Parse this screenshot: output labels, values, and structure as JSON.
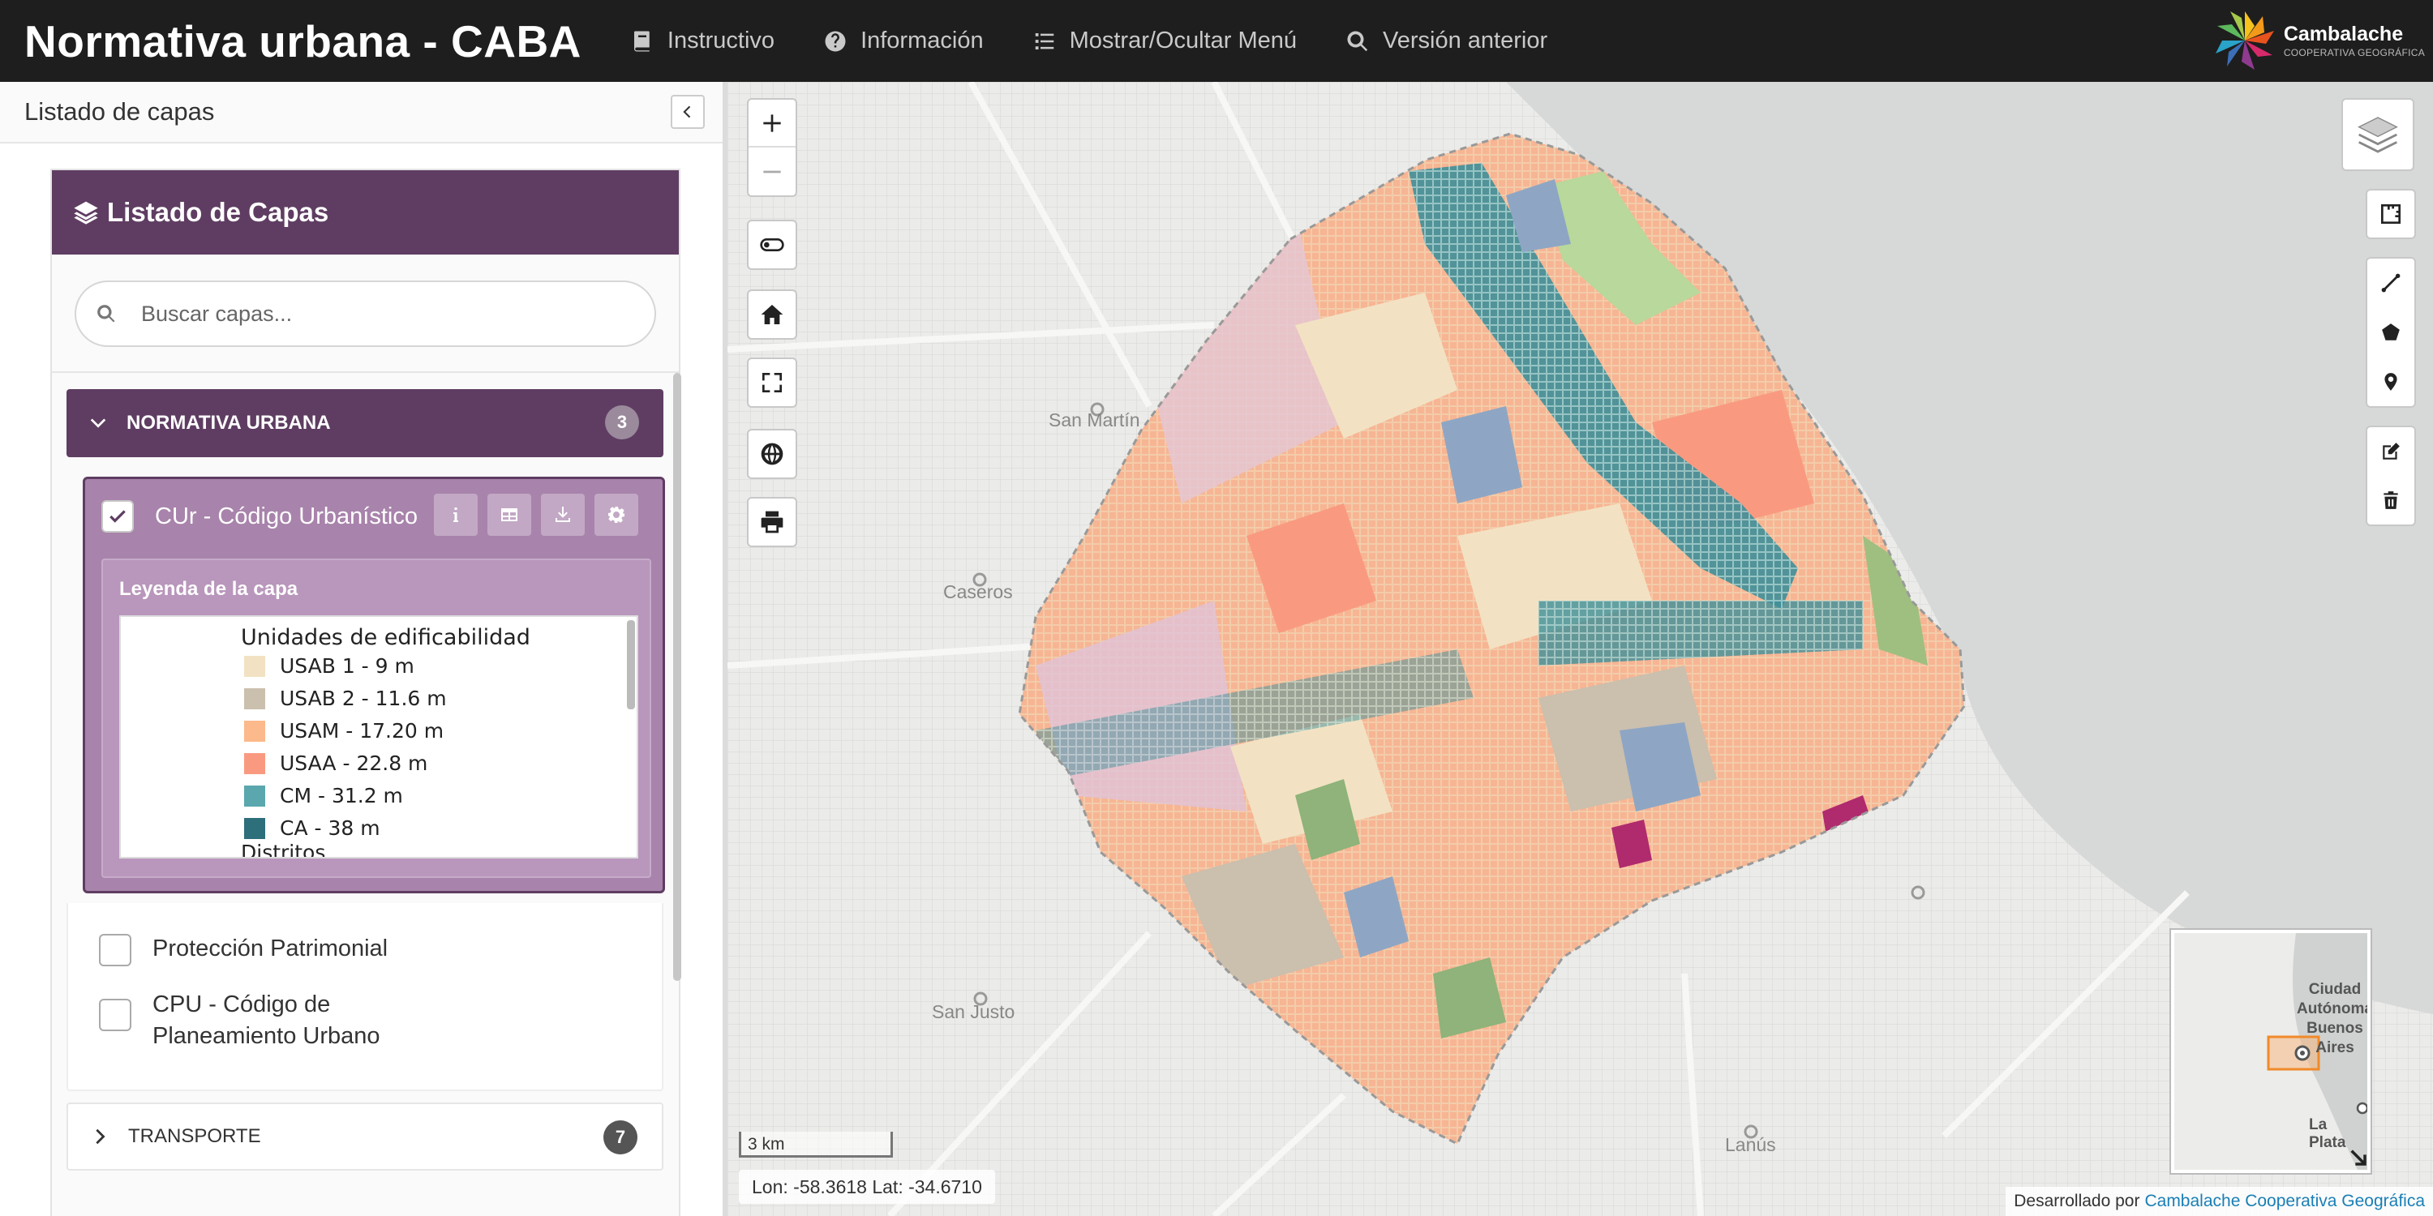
{
  "header": {
    "title": "Normativa urbana - CABA",
    "nav": [
      {
        "label": "Instructivo",
        "icon": "book-icon"
      },
      {
        "label": "Información",
        "icon": "question-circle-icon"
      },
      {
        "label": "Mostrar/Ocultar Menú",
        "icon": "list-icon"
      },
      {
        "label": "Versión anterior",
        "icon": "search-icon"
      }
    ],
    "logo": {
      "name": "Cambalache",
      "subtitle": "COOPERATIVA GEOGRÁFICA"
    }
  },
  "sidebar": {
    "heading": "Listado de capas",
    "panel_title": "Listado de Capas",
    "search": {
      "placeholder": "Buscar capas...",
      "value": ""
    },
    "groups": [
      {
        "label": "NORMATIVA URBANA",
        "count": "3",
        "expanded": true
      },
      {
        "label": "TRANSPORTE",
        "count": "7",
        "expanded": false
      }
    ],
    "active_layer": {
      "label": "CUr - Código Urbanístico",
      "checked": true,
      "legend_title": "Leyenda de la capa",
      "legend_heading": "Unidades de edificabilidad",
      "legend_items": [
        {
          "label": "USAB 1 - 9 m",
          "color": "#f2e2c3"
        },
        {
          "label": "USAB 2 - 11.6 m",
          "color": "#cbbfae"
        },
        {
          "label": "USAM - 17.20 m",
          "color": "#fcb98b"
        },
        {
          "label": "USAA - 22.8 m",
          "color": "#f99a80"
        },
        {
          "label": "CM - 31.2 m",
          "color": "#5aa7ad"
        },
        {
          "label": "CA - 38 m",
          "color": "#2d6f7b"
        }
      ],
      "legend_next": "Distritos"
    },
    "other_layers": [
      {
        "label": "Protección Patrimonial",
        "checked": false
      },
      {
        "label": "CPU - Código de Planeamiento Urbano",
        "checked": false
      }
    ]
  },
  "map": {
    "places": [
      "San Martín",
      "Caseros",
      "San Justo",
      "Lanús"
    ],
    "scale_label": "3 km",
    "coords": "Lon: -58.3618 Lat: -34.6710",
    "attribution_prefix": "Desarrollado por",
    "attribution_link": "Cambalache Cooperativa Geográfica",
    "minimap_labels": [
      "Ciudad Autónoma Buenos Aires",
      "La Plata"
    ]
  },
  "colors": {
    "header_bg": "#1e1e1e",
    "accent": "#5f3d62",
    "water": "#d6d9d8"
  }
}
